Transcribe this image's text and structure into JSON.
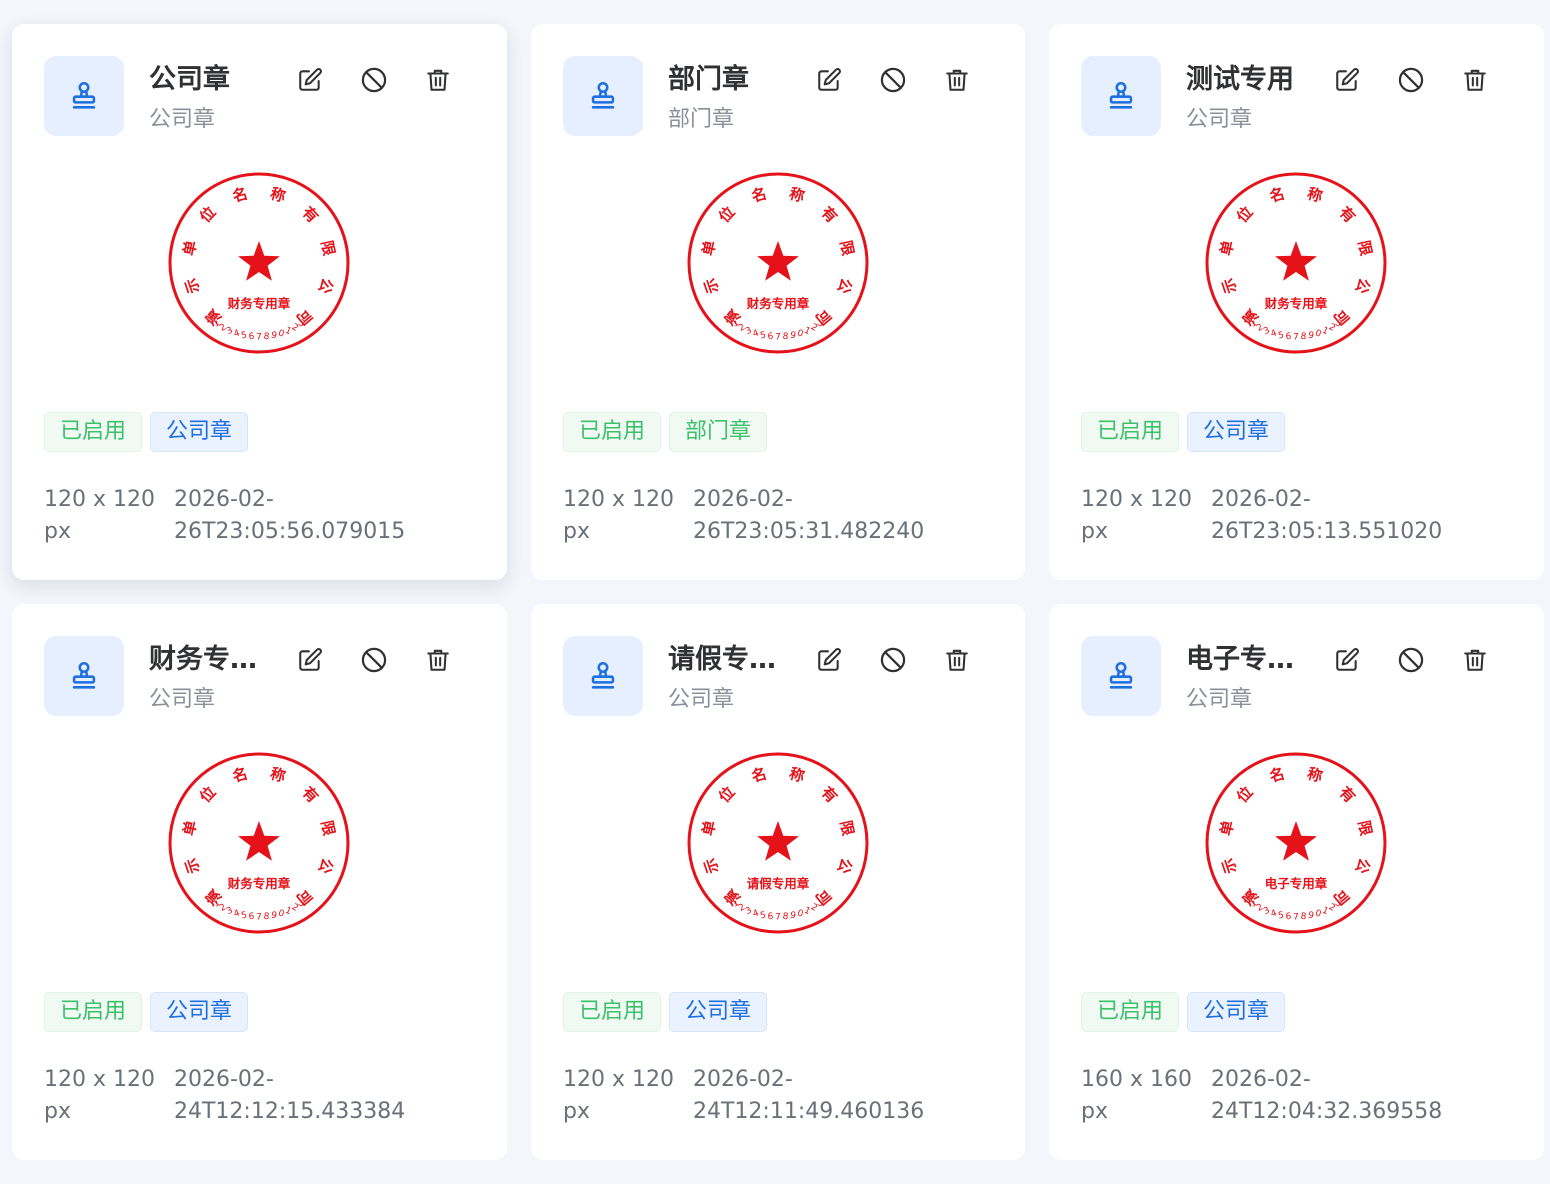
{
  "colors": {
    "accent": "#1e6fe0",
    "success": "#3cc06a",
    "seal_red": "#e5121a",
    "icon_bg": "#e6efff",
    "page_bg": "#f3f6fa"
  },
  "icons": {
    "head": "stamp-icon",
    "edit": "edit-icon",
    "disable": "ban-icon",
    "delete": "trash-icon"
  },
  "seal_ring_text": "演示单位名称有限公司",
  "seal_code": "1234567890123",
  "cards": [
    {
      "title": "公司章",
      "subtitle": "公司章",
      "seal_label": "财务专用章",
      "status_tag": "已启用",
      "type_tag": "公司章",
      "type_tag_style": "blue",
      "size_line1": "120 x 120",
      "size_line2": "px",
      "time_line1": "2026-02-",
      "time_line2": "26T23:05:56.079015"
    },
    {
      "title": "部门章",
      "subtitle": "部门章",
      "seal_label": "财务专用章",
      "status_tag": "已启用",
      "type_tag": "部门章",
      "type_tag_style": "green",
      "size_line1": "120 x 120",
      "size_line2": "px",
      "time_line1": "2026-02-",
      "time_line2": "26T23:05:31.482240"
    },
    {
      "title": "测试专用",
      "subtitle": "公司章",
      "seal_label": "财务专用章",
      "status_tag": "已启用",
      "type_tag": "公司章",
      "type_tag_style": "blue",
      "size_line1": "120 x 120",
      "size_line2": "px",
      "time_line1": "2026-02-",
      "time_line2": "26T23:05:13.551020"
    },
    {
      "title": "财务专用章",
      "subtitle": "公司章",
      "seal_label": "财务专用章",
      "status_tag": "已启用",
      "type_tag": "公司章",
      "type_tag_style": "blue",
      "size_line1": "120 x 120",
      "size_line2": "px",
      "time_line1": "2026-02-",
      "time_line2": "24T12:12:15.433384"
    },
    {
      "title": "请假专用章",
      "subtitle": "公司章",
      "seal_label": "请假专用章",
      "status_tag": "已启用",
      "type_tag": "公司章",
      "type_tag_style": "blue",
      "size_line1": "120 x 120",
      "size_line2": "px",
      "time_line1": "2026-02-",
      "time_line2": "24T12:11:49.460136"
    },
    {
      "title": "电子专用章",
      "subtitle": "公司章",
      "seal_label": "电子专用章",
      "status_tag": "已启用",
      "type_tag": "公司章",
      "type_tag_style": "blue",
      "size_line1": "160 x 160",
      "size_line2": "px",
      "time_line1": "2026-02-",
      "time_line2": "24T12:04:32.369558"
    }
  ]
}
